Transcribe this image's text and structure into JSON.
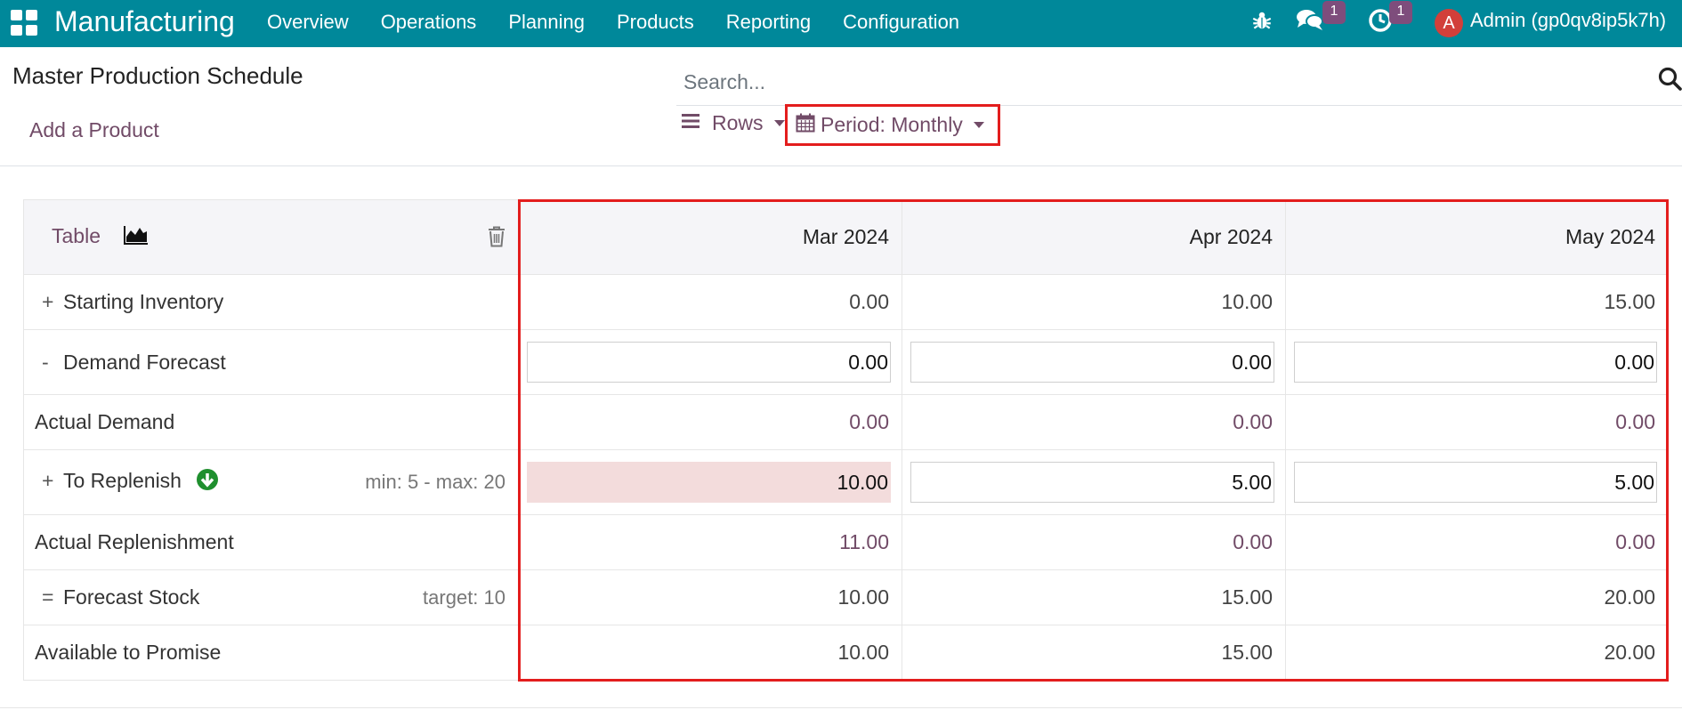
{
  "navbar": {
    "app_name": "Manufacturing",
    "menu": [
      "Overview",
      "Operations",
      "Planning",
      "Products",
      "Reporting",
      "Configuration"
    ],
    "messages_badge": "1",
    "activities_badge": "1",
    "avatar_initial": "A",
    "user": "Admin (gp0qv8ip5k7h)",
    "color": "#00889a"
  },
  "page": {
    "title": "Master Production Schedule",
    "search_placeholder": "Search...",
    "add_product_label": "Add a Product",
    "rows_label": "Rows",
    "period_label": "Period: Monthly",
    "accent_color": "#714b67",
    "highlight_color": "#e31d1d"
  },
  "table": {
    "view_table_label": "Table",
    "columns": [
      "Mar 2024",
      "Apr 2024",
      "May 2024"
    ],
    "rows": {
      "starting_inventory": {
        "op": "+",
        "label": "Starting Inventory",
        "values": [
          "0.00",
          "10.00",
          "15.00"
        ]
      },
      "demand_forecast": {
        "op": "-",
        "label": "Demand Forecast",
        "values": [
          "0.00",
          "0.00",
          "0.00"
        ]
      },
      "actual_demand": {
        "label": "Actual Demand",
        "values": [
          "0.00",
          "0.00",
          "0.00"
        ]
      },
      "to_replenish": {
        "op": "+",
        "label": "To Replenish",
        "hint": "min: 5 - max: 20",
        "values": [
          "10.00",
          "5.00",
          "5.00"
        ]
      },
      "actual_replenishment": {
        "label": "Actual Replenishment",
        "values": [
          "11.00",
          "0.00",
          "0.00"
        ]
      },
      "forecast_stock": {
        "op": "=",
        "label": "Forecast Stock",
        "hint": "target: 10",
        "values": [
          "10.00",
          "15.00",
          "20.00"
        ]
      },
      "available_to_promise": {
        "label": "Available to Promise",
        "values": [
          "10.00",
          "15.00",
          "20.00"
        ]
      }
    }
  }
}
